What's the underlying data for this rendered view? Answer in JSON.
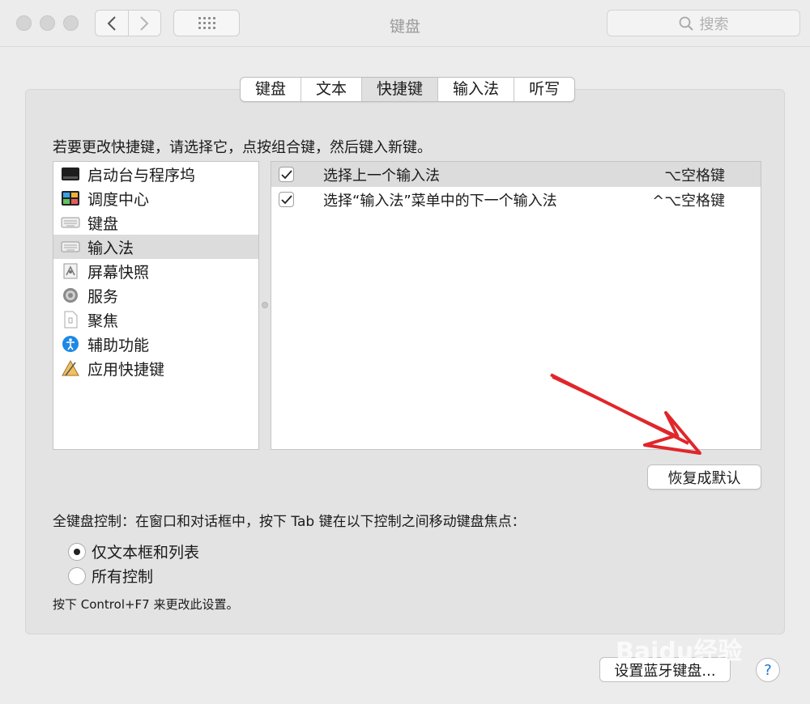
{
  "window": {
    "title": "键盘"
  },
  "search": {
    "placeholder": "搜索"
  },
  "tabs": [
    "键盘",
    "文本",
    "快捷键",
    "输入法",
    "听写"
  ],
  "instruction": "若要更改快捷键，请选择它，点按组合键，然后键入新键。",
  "categories": [
    {
      "label": "启动台与程序坞",
      "icon": "launchpad-dock-icon"
    },
    {
      "label": "调度中心",
      "icon": "mission-control-icon"
    },
    {
      "label": "键盘",
      "icon": "keyboard-icon"
    },
    {
      "label": "输入法",
      "icon": "input-source-icon",
      "selected": true
    },
    {
      "label": "屏幕快照",
      "icon": "screenshot-icon"
    },
    {
      "label": "服务",
      "icon": "gear-icon"
    },
    {
      "label": "聚焦",
      "icon": "spotlight-icon"
    },
    {
      "label": "辅助功能",
      "icon": "accessibility-icon"
    },
    {
      "label": "应用快捷键",
      "icon": "app-shortcuts-icon"
    }
  ],
  "shortcuts": [
    {
      "name": "选择上一个输入法",
      "keys": "⌥空格键",
      "checked": true
    },
    {
      "name": "选择“输入法”菜单中的下一个输入法",
      "keys": "^⌥空格键",
      "checked": true
    }
  ],
  "restore_button": "恢复成默认",
  "full_keyboard": {
    "label": "全键盘控制：在窗口和对话框中，按下 Tab 键在以下控制之间移动键盘焦点：",
    "options": [
      "仅文本框和列表",
      "所有控制"
    ],
    "selected": 0
  },
  "hint": "按下 Control+F7 来更改此设置。",
  "bluetooth_button": "设置蓝牙键盘...",
  "help": "?",
  "watermark": "Baidu经验",
  "colors": {
    "annotation_arrow": "#e0262b",
    "help_icon": "#1b6fd6",
    "selection": "#dcdcdc"
  }
}
